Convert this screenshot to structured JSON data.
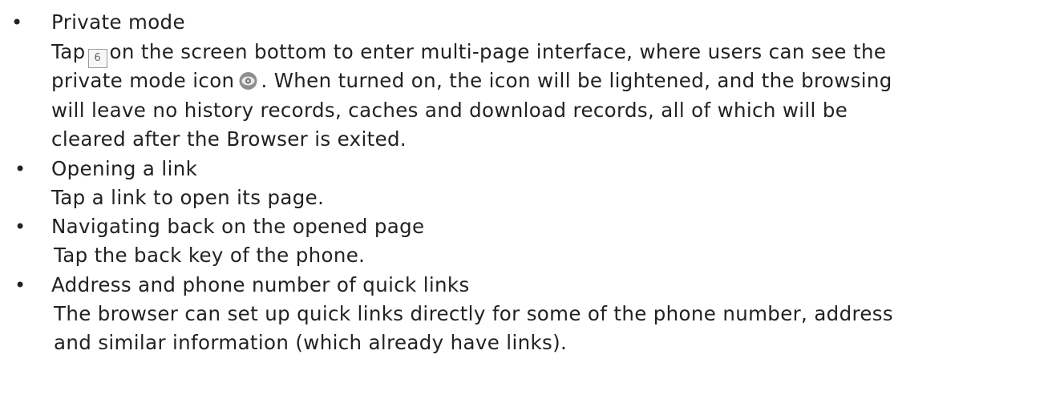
{
  "items": [
    {
      "title": "Private mode",
      "body": {
        "line1_a": "Tap",
        "tab_icon_text": "6",
        "line1_b": "on the screen bottom to enter multi-page interface, where users can see the",
        "line2_a": "private mode icon",
        "line2_b": ". When turned on, the icon will be lightened, and the browsing",
        "line3": "will leave no history records, caches and download records, all of which will be",
        "line4": "cleared after the Browser is exited."
      }
    },
    {
      "title": "Opening a link",
      "body": "Tap a link to open its page."
    },
    {
      "title": "Navigating back on the opened page",
      "body": "Tap the back key of the phone."
    },
    {
      "title": "Address and phone number of quick links",
      "body": {
        "line1": "The browser can set up quick links directly for some of the phone number, address",
        "line2": "and similar information (which already have links)."
      }
    }
  ],
  "bullet": "•",
  "icons": {
    "tab": "tab-count-icon",
    "private_mode": "private-mode-eye-icon"
  }
}
